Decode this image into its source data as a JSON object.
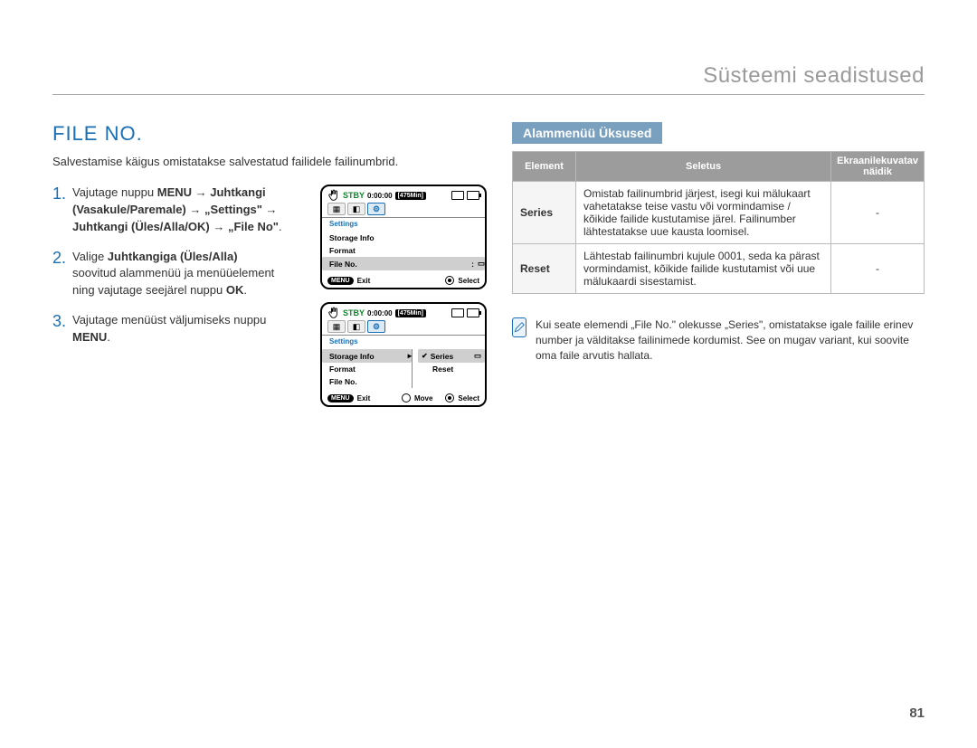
{
  "header": {
    "chapter": "Süsteemi seadistused"
  },
  "left": {
    "title": "FILE NO.",
    "intro": "Salvestamise käigus omistatakse salvestatud failidele failinumbrid.",
    "steps": [
      {
        "num": "1.",
        "pre": "Vajutage nuppu ",
        "b1": "MENU",
        "arrow1": " → ",
        "b2": "Juhtkangi (Vasakule/Paremale)",
        "arrow2": " → ",
        "b3": "„Settings\"",
        "arrow3": " → ",
        "b4": "Juhtkangi (Üles/Alla/OK)",
        "arrow4": " → ",
        "b5": "„File No\"",
        "tail": "."
      },
      {
        "num": "2.",
        "pre": "Valige ",
        "b1": "Juhtkangiga (Üles/Alla)",
        "mid": " soovitud alammenüü ja menüüelement ning vajutage seejärel nuppu ",
        "b2": "OK",
        "tail": "."
      },
      {
        "num": "3.",
        "pre": "Vajutage menüüst väljumiseks nuppu ",
        "b1": "MENU",
        "tail": "."
      }
    ],
    "lcd": {
      "stby": "STBY",
      "time": "0:00:00",
      "min": "[475Min]",
      "settings": "Settings",
      "items": [
        "Storage Info",
        "Format",
        "File No."
      ],
      "sub": {
        "series": "Series",
        "reset": "Reset"
      },
      "bottom": {
        "menu": "MENU",
        "exit": "Exit",
        "move": "Move",
        "select": "Select"
      }
    }
  },
  "right": {
    "subheading": "Alammenüü Üksused",
    "table": {
      "headers": {
        "element": "Element",
        "desc": "Seletus",
        "display": "Ekraanilekuvatav näidik"
      },
      "rows": [
        {
          "elem": "Series",
          "desc": "Omistab failinumbrid järjest, isegi kui mälukaart vahetatakse teise vastu või vormindamise / kõikide failide kustutamise järel. Failinumber lähtestatakse uue kausta loomisel.",
          "disp": "-"
        },
        {
          "elem": "Reset",
          "desc": "Lähtestab failinumbri kujule 0001, seda ka pärast vormindamist, kõikide failide kustutamist või uue mälukaardi sisestamist.",
          "disp": "-"
        }
      ]
    },
    "note": "Kui seate elemendi „File No.\" olekusse „Series\", omistatakse igale failile erinev number ja välditakse failinimede kordumist. See on mugav variant, kui soovite oma faile arvutis hallata."
  },
  "pagenum": "81"
}
